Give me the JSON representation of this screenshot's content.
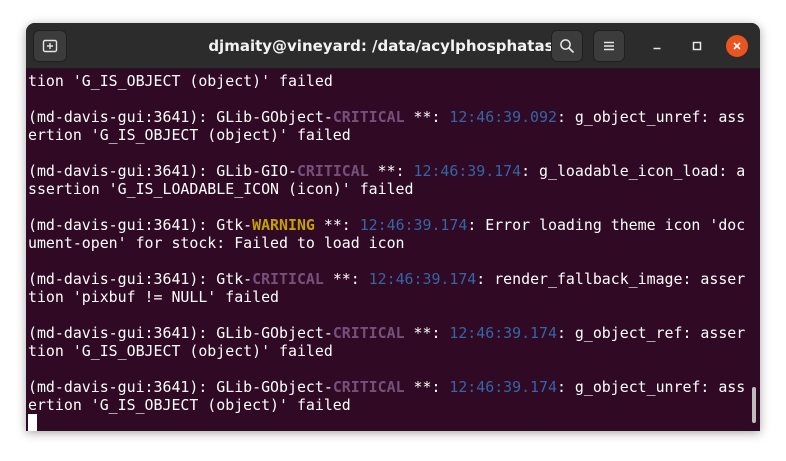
{
  "window": {
    "title": "djmaity@vineyard: /data/acylphosphatase"
  },
  "terminal": {
    "colors": {
      "background": "#300a24",
      "text": "#ffffff",
      "critical": "#75507b",
      "warning": "#c4a000",
      "timestamp": "#3465a4"
    },
    "lines": [
      [
        {
          "t": "tion 'G_IS_OBJECT (object)' failed"
        }
      ],
      [],
      [
        {
          "t": "(md-davis-gui:3641): GLib-GObject-"
        },
        {
          "t": "CRITICAL",
          "c": "crit"
        },
        {
          "t": " **: "
        },
        {
          "t": "12:46:39.092",
          "c": "ts"
        },
        {
          "t": ": g_object_unref: ass"
        }
      ],
      [
        {
          "t": "ertion 'G_IS_OBJECT (object)' failed"
        }
      ],
      [],
      [
        {
          "t": "(md-davis-gui:3641): GLib-GIO-"
        },
        {
          "t": "CRITICAL",
          "c": "crit"
        },
        {
          "t": " **: "
        },
        {
          "t": "12:46:39.174",
          "c": "ts"
        },
        {
          "t": ": g_loadable_icon_load: a"
        }
      ],
      [
        {
          "t": "ssertion 'G_IS_LOADABLE_ICON (icon)' failed"
        }
      ],
      [],
      [
        {
          "t": "(md-davis-gui:3641): Gtk-"
        },
        {
          "t": "WARNING",
          "c": "warn"
        },
        {
          "t": " **: "
        },
        {
          "t": "12:46:39.174",
          "c": "ts"
        },
        {
          "t": ": Error loading theme icon 'doc"
        }
      ],
      [
        {
          "t": "ument-open' for stock: Failed to load icon"
        }
      ],
      [],
      [
        {
          "t": "(md-davis-gui:3641): Gtk-"
        },
        {
          "t": "CRITICAL",
          "c": "crit"
        },
        {
          "t": " **: "
        },
        {
          "t": "12:46:39.174",
          "c": "ts"
        },
        {
          "t": ": render_fallback_image: asser"
        }
      ],
      [
        {
          "t": "tion 'pixbuf != NULL' failed"
        }
      ],
      [],
      [
        {
          "t": "(md-davis-gui:3641): GLib-GObject-"
        },
        {
          "t": "CRITICAL",
          "c": "crit"
        },
        {
          "t": " **: "
        },
        {
          "t": "12:46:39.174",
          "c": "ts"
        },
        {
          "t": ": g_object_ref: asser"
        }
      ],
      [
        {
          "t": "tion 'G_IS_OBJECT (object)' failed"
        }
      ],
      [],
      [
        {
          "t": "(md-davis-gui:3641): GLib-GObject-"
        },
        {
          "t": "CRITICAL",
          "c": "crit"
        },
        {
          "t": " **: "
        },
        {
          "t": "12:46:39.174",
          "c": "ts"
        },
        {
          "t": ": g_object_unref: ass"
        }
      ],
      [
        {
          "t": "ertion 'G_IS_OBJECT (object)' failed"
        }
      ]
    ]
  }
}
